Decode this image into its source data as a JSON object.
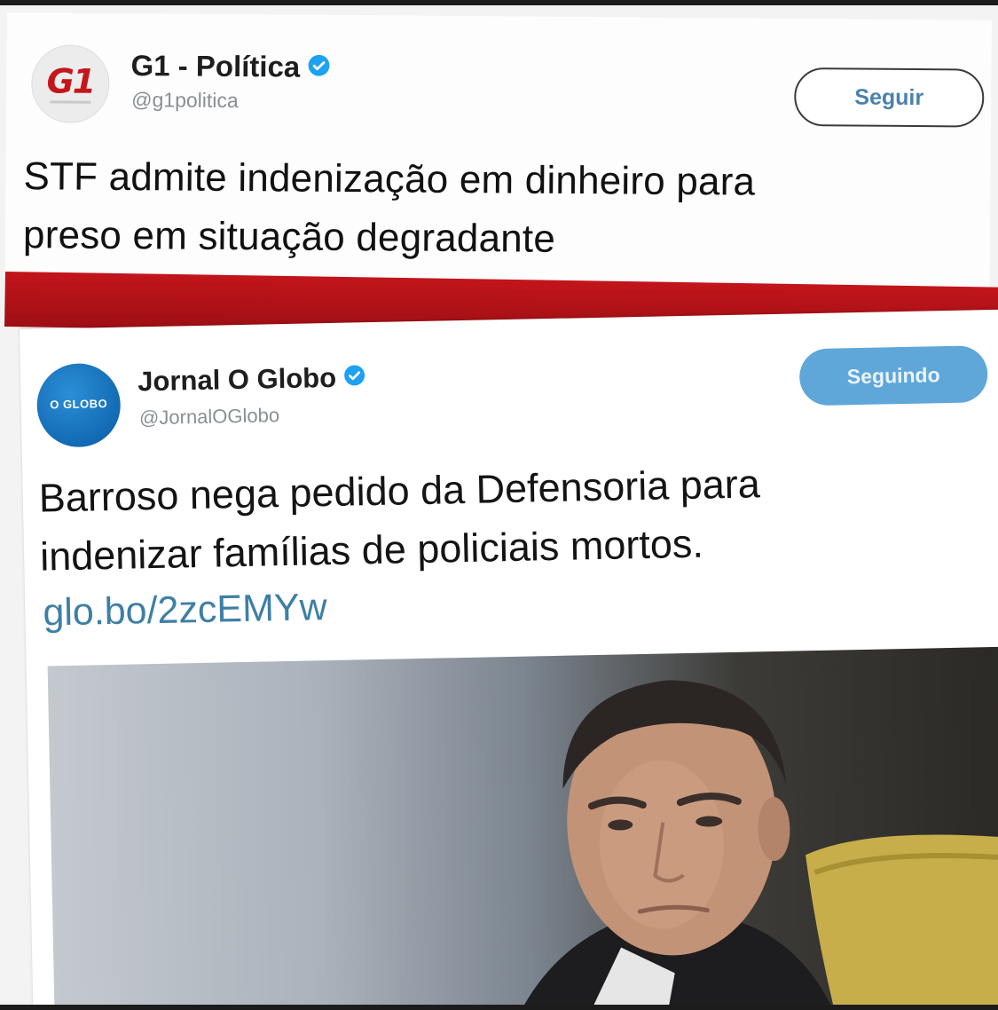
{
  "tweets": [
    {
      "account_name": "G1 - Política",
      "handle": "@g1politica",
      "logo_text": "G1",
      "verified": true,
      "button_label": "Seguir",
      "text_line1": "STF admite indenização em dinheiro para",
      "text_line2": "preso em situação degradante"
    },
    {
      "account_name": "Jornal O Globo",
      "handle": "@JornalOGlobo",
      "logo_text": "O GLOBO",
      "verified": true,
      "button_label": "Seguindo",
      "text_line1": "Barroso nega pedido da Defensoria para",
      "text_line2": "indenizar famílias de policiais mortos.",
      "link": "glo.bo/2zcEMYw"
    }
  ],
  "colors": {
    "g1_red": "#c4161c",
    "verified_blue": "#1da1f2",
    "following_button": "#5fa7d8",
    "link": "#3e7fa5"
  },
  "icons": {
    "verified": "verified-badge-icon"
  }
}
